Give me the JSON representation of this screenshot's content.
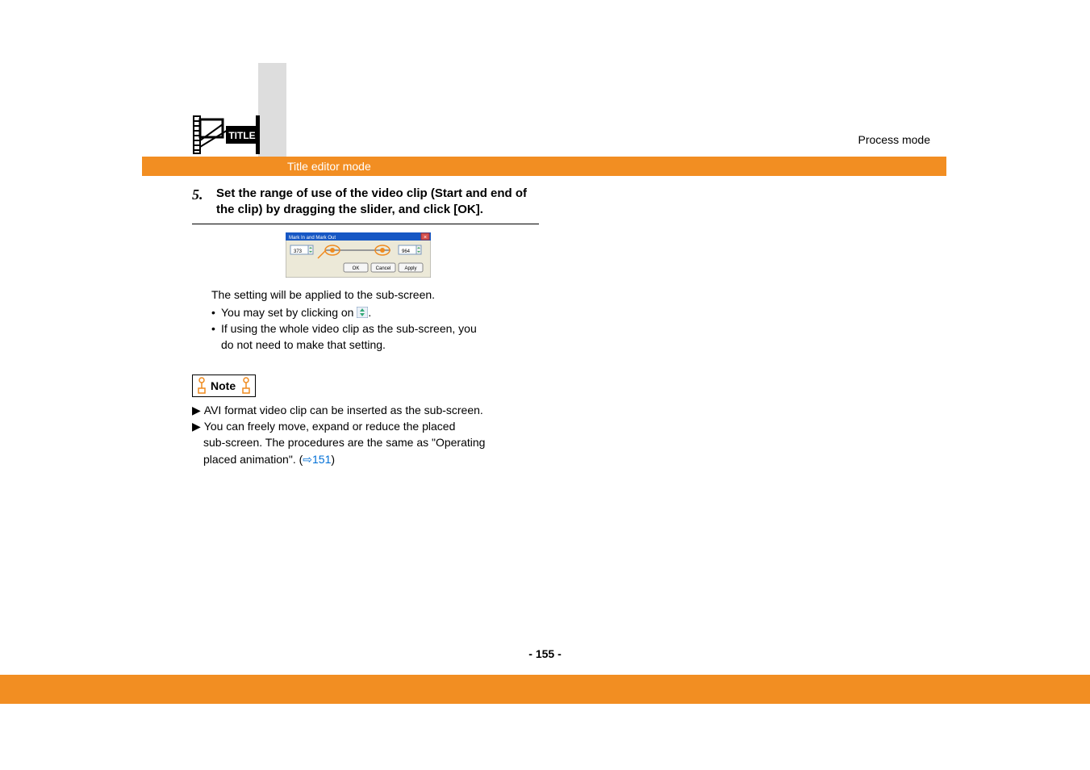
{
  "header": {
    "process_mode": "Process mode",
    "title_editor_mode": "Title editor mode"
  },
  "step": {
    "number": "5.",
    "instruction": "Set the range of use of the video clip (Start and end of the clip) by dragging the slider, and click [OK]."
  },
  "dialog": {
    "title": "Mark In and Mark Out",
    "in_value": "373",
    "out_value": "964",
    "buttons": {
      "ok": "OK",
      "cancel": "Cancel",
      "apply": "Apply"
    }
  },
  "applied_text": "The setting will be applied to the sub-screen.",
  "bullets": {
    "b1_prefix": "You may set by clicking on ",
    "b1_suffix": ".",
    "b2_line1": "If using the whole video clip as the sub-screen, you",
    "b2_line2": "do not need to make that setting."
  },
  "note": {
    "label": "Note",
    "n1": "AVI format video clip can be inserted as the sub-screen.",
    "n2_line1": "You can freely move, expand or reduce the placed",
    "n2_line2": "sub-screen. The procedures are the same as \"Operating",
    "n2_line3_prefix": "placed animation\". (",
    "link": "151",
    "n2_line3_suffix": ")"
  },
  "page_number": "- 155 -"
}
